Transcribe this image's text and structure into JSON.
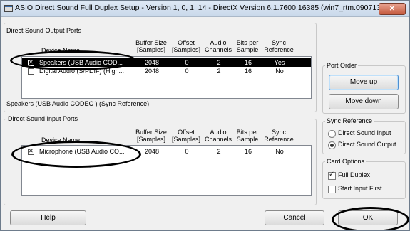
{
  "window": {
    "title": "ASIO Direct Sound Full Duplex Setup  -  Version 1, 0, 1, 14  -  DirectX Version 6.1.7600.16385 (win7_rtm.090713...",
    "close_label": "✕"
  },
  "columns": {
    "device_name": "Device Name",
    "buffer_size": [
      "Buffer Size",
      "[Samples]"
    ],
    "offset": [
      "Offset",
      "[Samples]"
    ],
    "audio_channels": [
      "Audio",
      "Channels"
    ],
    "bits_per_sample": [
      "Bits per",
      "Sample"
    ],
    "sync_reference": [
      "Sync",
      "Reference"
    ]
  },
  "output_ports": {
    "title": "Direct Sound Output Ports",
    "rows": [
      {
        "checked": true,
        "selected": true,
        "name": "Speakers (USB Audio COD...",
        "buffer": "2048",
        "offset": "0",
        "channels": "2",
        "bits": "16",
        "sync": "Yes"
      },
      {
        "checked": false,
        "selected": false,
        "name": "Digital Audio (S/PDIF) (High...",
        "buffer": "2048",
        "offset": "0",
        "channels": "2",
        "bits": "16",
        "sync": "No"
      }
    ],
    "status": "Speakers (USB Audio CODEC ) (Sync Reference)"
  },
  "input_ports": {
    "title": "Direct Sound Input Ports",
    "rows": [
      {
        "checked": true,
        "selected": false,
        "name": "Microphone (USB Audio CO...",
        "buffer": "2048",
        "offset": "0",
        "channels": "2",
        "bits": "16",
        "sync": "No"
      }
    ]
  },
  "port_order": {
    "title": "Port Order",
    "move_up": "Move up",
    "move_down": "Move down"
  },
  "sync_reference": {
    "title": "Sync Reference",
    "options": [
      {
        "label": "Direct Sound Input",
        "selected": false
      },
      {
        "label": "Direct Sound Output",
        "selected": true
      }
    ]
  },
  "card_options": {
    "title": "Card Options",
    "full_duplex": {
      "label": "Full Duplex",
      "checked": true
    },
    "start_input_first": {
      "label": "Start Input First",
      "checked": false
    }
  },
  "buttons": {
    "help": "Help",
    "cancel": "Cancel",
    "ok": "OK"
  },
  "colors": {
    "selection_bg": "#000000",
    "annotation": "#000000",
    "titlebar": "#c9d8ea"
  }
}
